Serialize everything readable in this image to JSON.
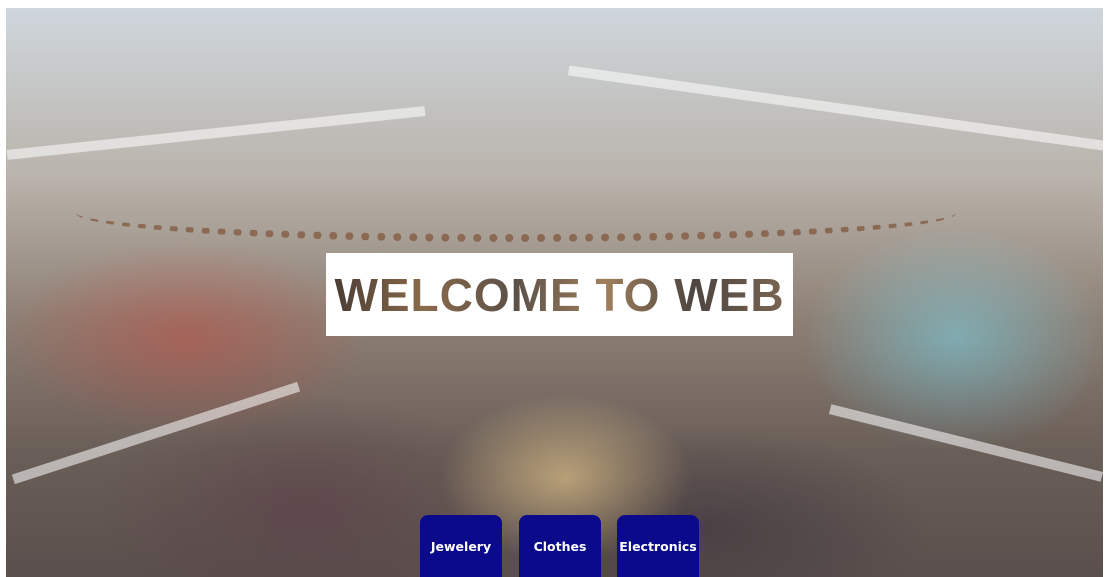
{
  "hero": {
    "heading": "WELCOME TO WEB"
  },
  "nav": {
    "buttons": [
      {
        "label": "Jewelery"
      },
      {
        "label": "Clothes"
      },
      {
        "label": "Electronics"
      }
    ]
  },
  "colors": {
    "button_bg": "#0a0a8a",
    "button_text": "#ffffff",
    "heading_box": "#ffffff"
  }
}
